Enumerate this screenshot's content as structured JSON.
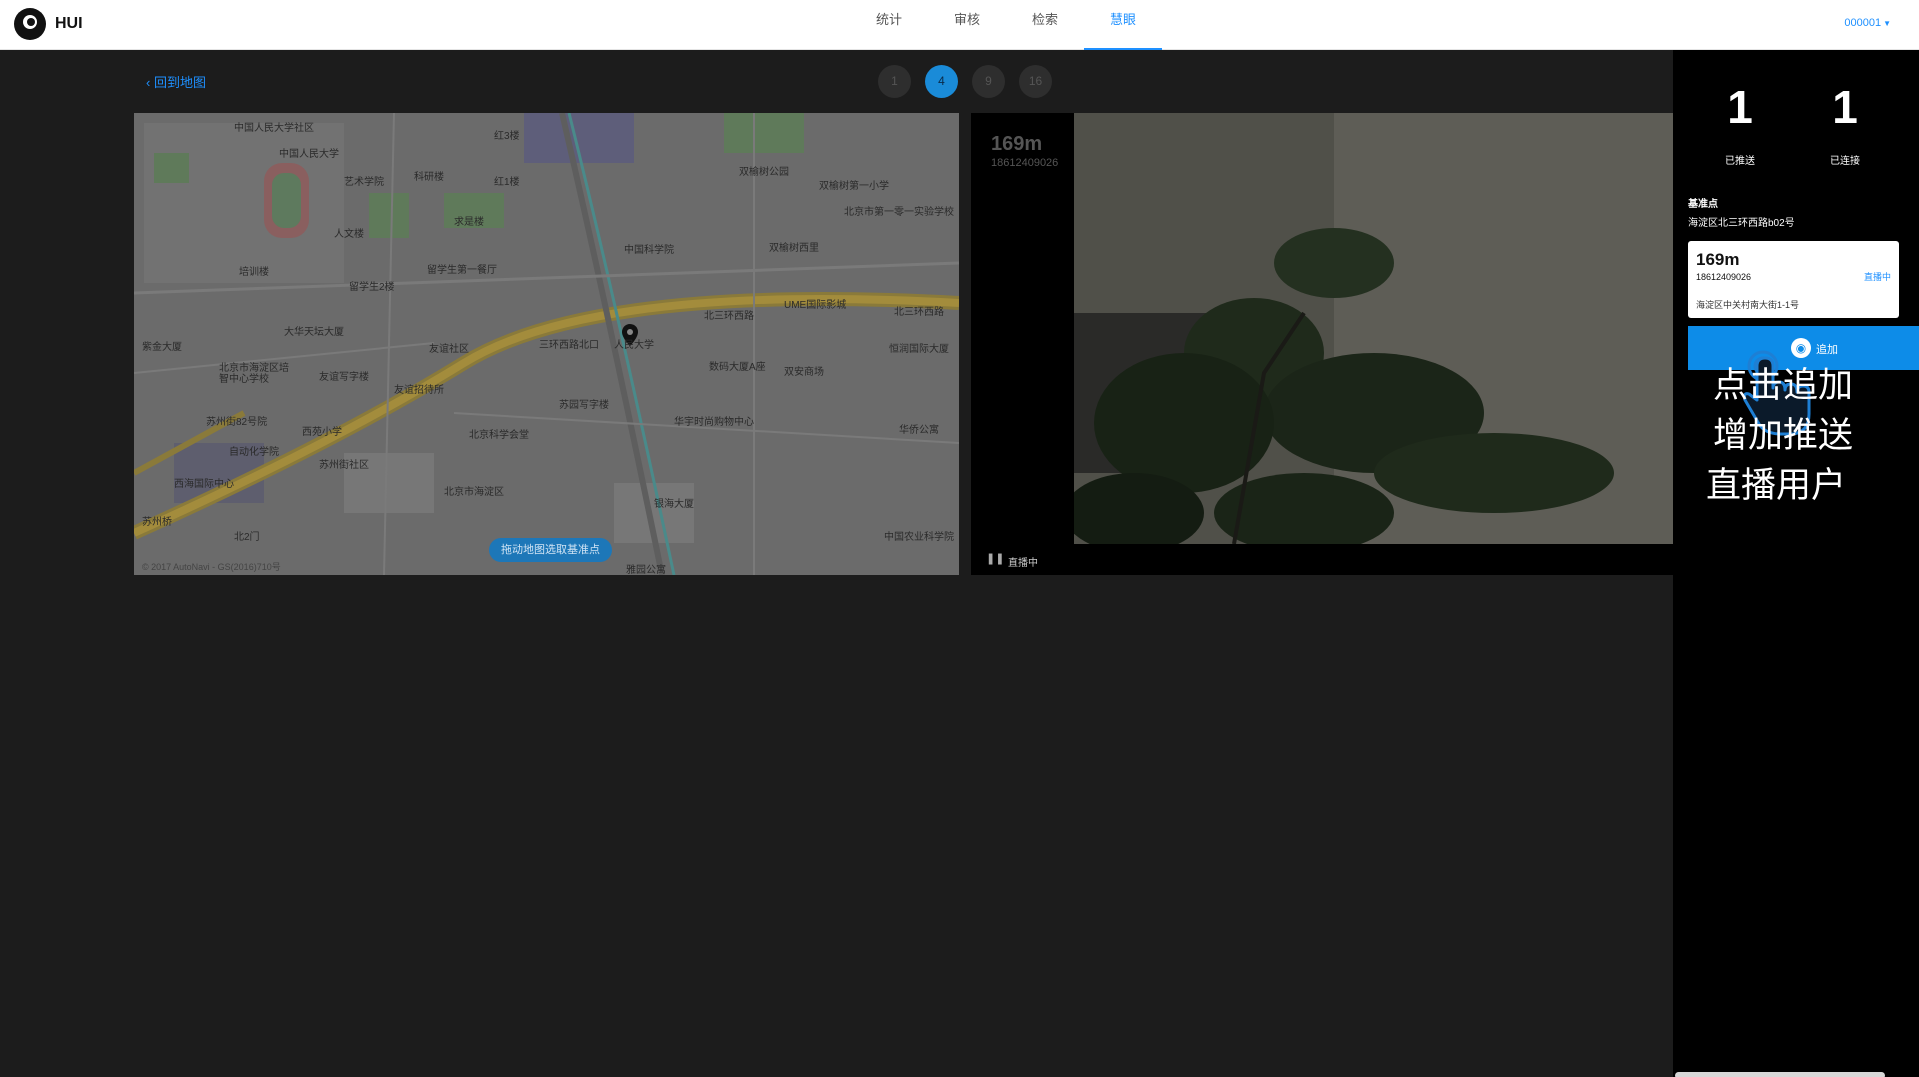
{
  "header": {
    "brand": "HUI",
    "nav": [
      {
        "label": "统计",
        "active": false
      },
      {
        "label": "审核",
        "active": false
      },
      {
        "label": "检索",
        "active": false
      },
      {
        "label": "慧眼",
        "active": true
      }
    ],
    "user": "000001"
  },
  "main": {
    "back_label": "回到地图",
    "pages": [
      "1",
      "4",
      "9",
      "16"
    ],
    "active_page": "4"
  },
  "map": {
    "labels": [
      "中国人民大学社区",
      "中国人民大学",
      "红3楼",
      "双榆树公园",
      "双榆树第一小学",
      "北京市第一零一实验学校",
      "艺术学院",
      "科研楼",
      "红1楼",
      "求是楼",
      "人文楼",
      "培训楼",
      "留学生2楼",
      "留学生第一餐厅",
      "双榆树西里",
      "中国科学院",
      "UME国际影城",
      "北三环西路",
      "北三环西路",
      "紫金大厦",
      "大华天坛大厦",
      "友谊社区",
      "三环西路北口",
      "人民大学",
      "数码大厦A座",
      "双安商场",
      "恒润国际大厦",
      "北京市海淀区培智中心学校",
      "友谊写字楼",
      "友谊招待所",
      "苏州街82号院",
      "西苑小学",
      "苏园写字楼",
      "北京科学会堂",
      "华宇时尚购物中心",
      "华侨公寓",
      "自动化学院",
      "苏州街社区",
      "西海国际中心",
      "苏州桥",
      "北京市海淀区",
      "银海大厦",
      "中国农业科学院",
      "北2门",
      "雅园公寓"
    ],
    "button_label": "拖动地图选取基准点",
    "copyright": "© 2017 AutoNavi - GS(2016)710号"
  },
  "video": {
    "distance": "169m",
    "phone": "18612409026",
    "status": "直播中"
  },
  "panel": {
    "stats": [
      {
        "value": "1",
        "label": "已推送"
      },
      {
        "value": "1",
        "label": "已连接"
      }
    ],
    "base_title": "基准点",
    "base_addr": "海淀区北三环西路b02号",
    "card": {
      "distance": "169m",
      "phone": "18612409026",
      "status": "直播中",
      "address": "海淀区中关村南大街1-1号"
    },
    "add_label": "追加",
    "tips": [
      "点击追加",
      "增加推送",
      "直播用户"
    ]
  },
  "colors": {
    "accent": "#1e90ff",
    "panel_bg": "#000000",
    "page_bg": "#1c1c1c"
  }
}
